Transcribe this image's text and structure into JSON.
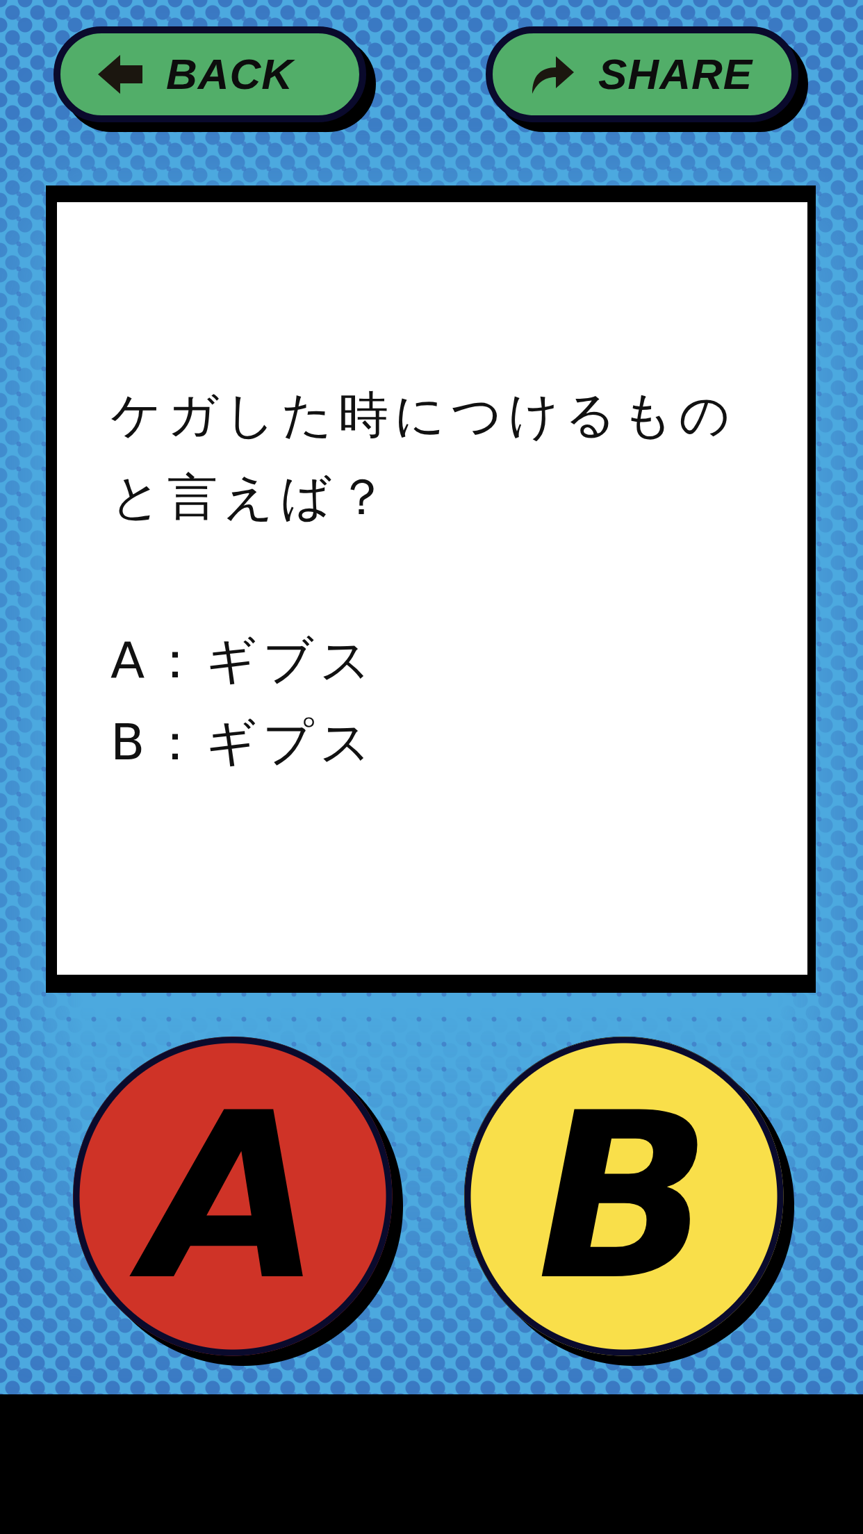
{
  "nav": {
    "buttons": [
      {
        "kind": "back",
        "label": "BACK"
      },
      {
        "kind": "share",
        "label": "SHARE"
      }
    ]
  },
  "quiz": {
    "question": "ケガした時につけるものと言えば？",
    "options": [
      "A：ギブス",
      "B：ギプス"
    ]
  },
  "answers": [
    {
      "label": "A",
      "color": "#cf3327"
    },
    {
      "label": "B",
      "color": "#f9df4a"
    }
  ]
}
